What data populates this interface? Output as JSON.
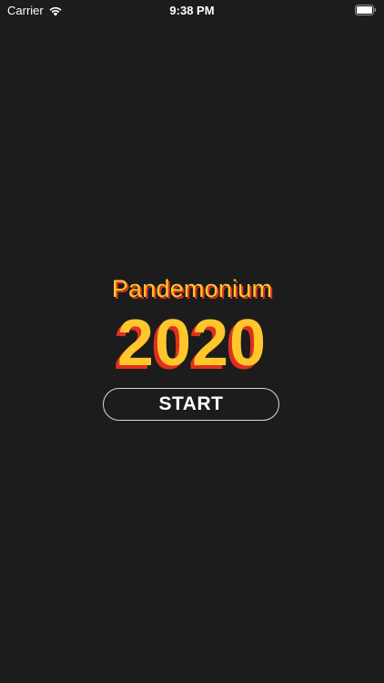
{
  "status_bar": {
    "carrier": "Carrier",
    "time": "9:38 PM",
    "wifi_icon": "wifi-icon",
    "battery_icon": "battery-full-icon"
  },
  "title": {
    "subtitle": "Pandemonium",
    "year": "2020"
  },
  "start_button": {
    "label": "START"
  },
  "colors": {
    "background": "#1c1c1c",
    "title_fill": "#ffc72c",
    "title_shadow": "#e0301e",
    "button_border": "#d9d9d9",
    "text": "#ffffff"
  }
}
